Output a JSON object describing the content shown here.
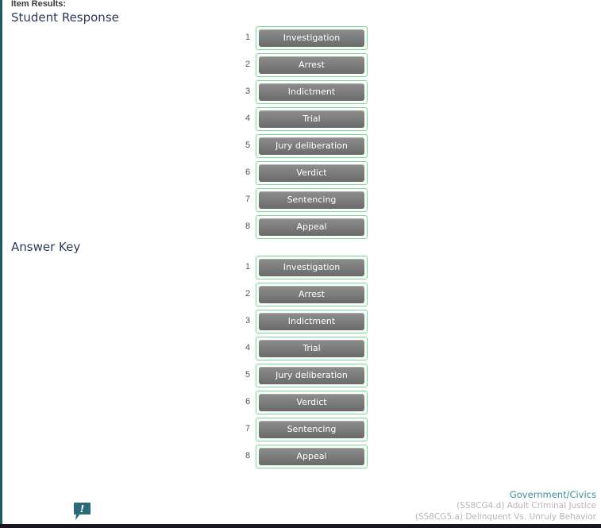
{
  "header": {
    "item_results_label": "Item Results:"
  },
  "student_response": {
    "title": "Student Response",
    "items": [
      {
        "number": "1",
        "label": "Investigation"
      },
      {
        "number": "2",
        "label": "Arrest"
      },
      {
        "number": "3",
        "label": "Indictment"
      },
      {
        "number": "4",
        "label": "Trial"
      },
      {
        "number": "5",
        "label": "Jury deliberation"
      },
      {
        "number": "6",
        "label": "Verdict"
      },
      {
        "number": "7",
        "label": "Sentencing"
      },
      {
        "number": "8",
        "label": "Appeal"
      }
    ]
  },
  "answer_key": {
    "title": "Answer Key",
    "items": [
      {
        "number": "1",
        "label": "Investigation"
      },
      {
        "number": "2",
        "label": "Arrest"
      },
      {
        "number": "3",
        "label": "Indictment"
      },
      {
        "number": "4",
        "label": "Trial"
      },
      {
        "number": "5",
        "label": "Jury deliberation"
      },
      {
        "number": "6",
        "label": "Verdict"
      },
      {
        "number": "7",
        "label": "Sentencing"
      },
      {
        "number": "8",
        "label": "Appeal"
      }
    ]
  },
  "standards": {
    "subject": "Government/Civics",
    "lines": [
      "(SS8CG4.d) Adult Criminal Justice",
      "(SS8CG5.a) Delinquent Vs. Unruly Behavior"
    ]
  },
  "feedback": {
    "icon": "feedback-exclamation-icon",
    "color": "#2b6a78"
  },
  "colors": {
    "accent": "#1f5a62",
    "slot_border": "#7fd49a",
    "button": "#7a7a7a"
  }
}
